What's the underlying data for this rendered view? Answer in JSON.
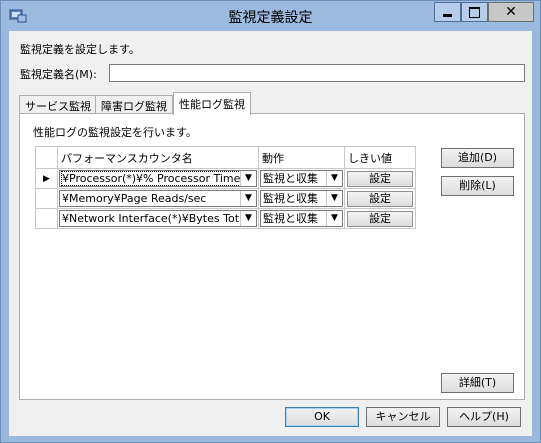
{
  "window": {
    "title": "監視定義設定",
    "close_glyph": "✕"
  },
  "form": {
    "description": "監視定義を設定します。",
    "name_label": "監視定義名(M):",
    "name_value": ""
  },
  "tabs": [
    {
      "label": "サービス監視",
      "active": false
    },
    {
      "label": "障害ログ監視",
      "active": false
    },
    {
      "label": "性能ログ監視",
      "active": true
    }
  ],
  "panel": {
    "description": "性能ログの監視設定を行います。",
    "columns": [
      "パフォーマンスカウンタ名",
      "動作",
      "しきい値"
    ],
    "current_row_marker": "▶",
    "rows": [
      {
        "counter": "¥Processor(*)¥% Processor Time",
        "action": "監視と収集",
        "threshold": "設定"
      },
      {
        "counter": "¥Memory¥Page Reads/sec",
        "action": "監視と収集",
        "threshold": "設定"
      },
      {
        "counter": "¥Network Interface(*)¥Bytes Tot...",
        "action": "監視と収集",
        "threshold": "設定"
      }
    ],
    "add_label": "追加(D)",
    "delete_label": "削除(L)",
    "details_label": "詳細(T)"
  },
  "footer": {
    "ok_label": "OK",
    "cancel_label": "キャンセル",
    "help_label": "ヘルプ(H)"
  }
}
